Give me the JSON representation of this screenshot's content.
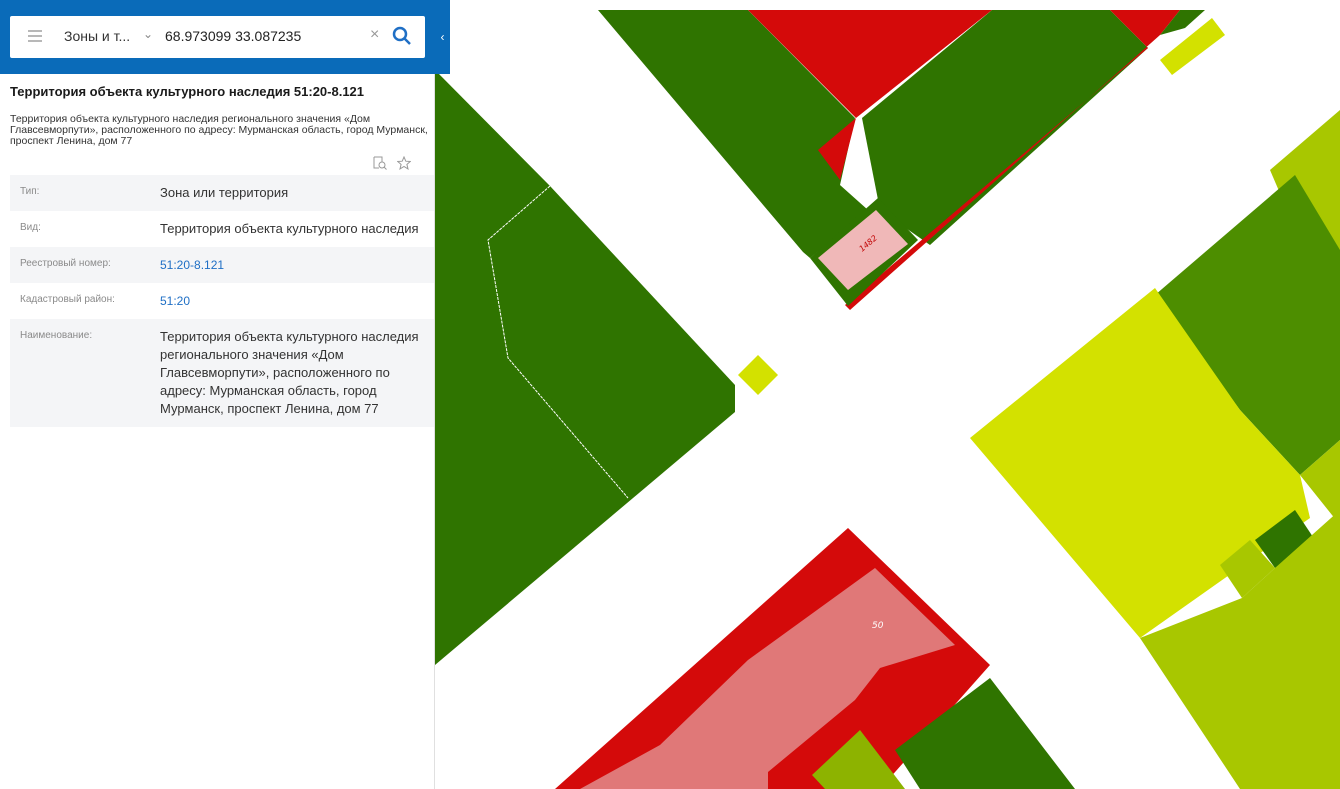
{
  "search": {
    "layer_label": "Зоны и т...",
    "coords_value": "68.973099 33.087235"
  },
  "object": {
    "title": "Территория объекта культурного наследия 51:20-8.121",
    "description": "Территория объекта культурного наследия регионального значения «Дом Главсевморпути», расположенного по адресу: Мурманская область, город Мурманск, проспект Ленина, дом 77"
  },
  "properties": [
    {
      "key": "Тип:",
      "value": "Зона или территория"
    },
    {
      "key": "Вид:",
      "value": "Территория объекта культурного наследия"
    },
    {
      "key": "Реестровый номер:",
      "value": "51:20-8.121"
    },
    {
      "key": "Кадастровый район:",
      "value": "51:20"
    },
    {
      "key": "Наименование:",
      "value": "Территория объекта культурного наследия регионального значения «Дом Главсевморпути», расположенного по адресу: Мурманская область, город Мурманск, проспект Ленина, дом 77"
    }
  ],
  "map": {
    "labels": [
      "1482",
      "50"
    ],
    "colors": {
      "dark_green": "#2f7400",
      "red": "#d40a0a",
      "yellow": "#d3e100",
      "light_green": "#a8c700",
      "pink": "#e07878"
    }
  }
}
